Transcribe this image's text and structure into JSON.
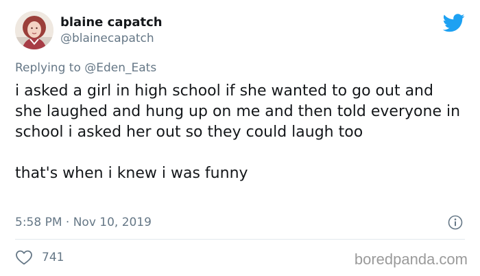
{
  "author": {
    "display_name": "blaine capatch",
    "handle": "@blainecapatch",
    "avatar_icon": "profile-photo"
  },
  "reply": {
    "prefix": "Replying to ",
    "to_handle": "@Eden_Eats"
  },
  "tweet": {
    "paragraph_1": "i asked a girl in high school if she wanted to go out and she laughed and hung up on me and then told everyone in school i asked her out so they could laugh too",
    "paragraph_2": "that's when i knew i was funny"
  },
  "meta": {
    "timestamp": "5:58 PM · Nov 10, 2019"
  },
  "actions": {
    "like_count": "741",
    "like_icon": "heart-icon",
    "info_icon": "info-icon"
  },
  "branding": {
    "logo_icon": "twitter-bird-icon",
    "watermark": "boredpanda.com"
  },
  "colors": {
    "twitter_blue": "#1da1f2",
    "secondary_text": "#657786",
    "primary_text": "#14171a",
    "divider": "#e1e8ed",
    "watermark": "#9a9a9a"
  }
}
